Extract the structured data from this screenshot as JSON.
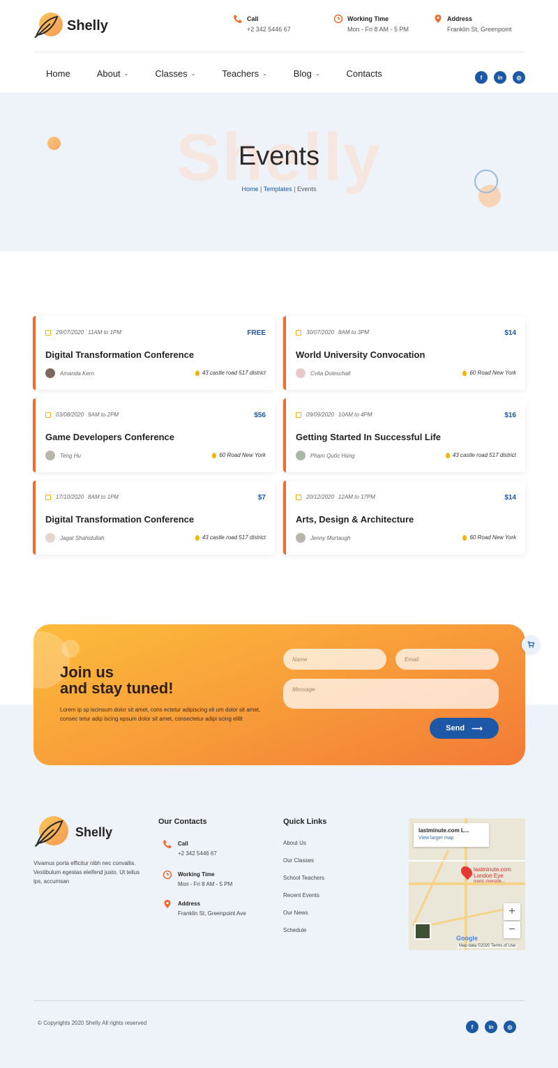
{
  "brand": {
    "name": "Shelly"
  },
  "header": {
    "call": {
      "title": "Call",
      "value": "+2 342 5446 67"
    },
    "working": {
      "title": "Working Time",
      "value": "Mon - Fri 8 AM - 5 PM"
    },
    "address": {
      "title": "Address",
      "value": "Franklin St, Greenpoint"
    }
  },
  "nav": {
    "items": [
      {
        "label": "Home"
      },
      {
        "label": "About"
      },
      {
        "label": "Classes"
      },
      {
        "label": "Teachers"
      },
      {
        "label": "Blog"
      },
      {
        "label": "Contacts"
      }
    ],
    "chevron": "⌄"
  },
  "social": {
    "facebook": "f",
    "linkedin": "in",
    "instagram": "◎"
  },
  "hero": {
    "bg_text": "Shelly",
    "title": "Events",
    "breadcrumb": {
      "home": "Home",
      "sep": " | ",
      "templates": "Templates",
      "current": "Events"
    }
  },
  "events": [
    {
      "date": "29/07/2020",
      "time": "11AM to 1PM",
      "price": "FREE",
      "title": "Digital Transformation Conference",
      "person": "Amanda Kern",
      "location": "43 castle road 517 district"
    },
    {
      "date": "30/07/2020",
      "time": "8AM to 3PM",
      "price": "$14",
      "title": "World University Convocation",
      "person": "Cvita Doleschall",
      "location": "60 Road New York"
    },
    {
      "date": "03/08/2020",
      "time": "9AM to 2PM",
      "price": "$56",
      "title": "Game Developers Conference",
      "person": "Teng Hu",
      "location": "60 Road New York"
    },
    {
      "date": "09/09/2020",
      "time": "10AM to 4PM",
      "price": "$16",
      "title": "Getting Started In Successful Life",
      "person": "Phạm Quốc Hùng",
      "location": "43 castle road 517 district"
    },
    {
      "date": "17/10/2020",
      "time": "8AM to 1PM",
      "price": "$7",
      "title": "Digital Transformation Conference",
      "person": "Jagat Shahidullah",
      "location": "43 castle road 517 district"
    },
    {
      "date": "20/12/2020",
      "time": "12AM to 17PM",
      "price": "$14",
      "title": "Arts, Design & Architecture",
      "person": "Jenny Murtaugh",
      "location": "60 Road New York"
    }
  ],
  "newsletter": {
    "heading_line1": "Join us",
    "heading_line2": "and stay tuned!",
    "text": "Lorem ip sp iscinsum dolor sit amet, cons ectetur adipiscing eli um dolor sit amet, consec tetur adip iscing epsum dolor sit amet, consectetur adipi scing elilit",
    "name_placeholder": "Name",
    "email_placeholder": "Email",
    "message_placeholder": "Message",
    "send_label": "Send",
    "send_arrow": "⟶"
  },
  "footer": {
    "about": "Vivamus porta efficitur nibh nec convallis. Vestibulum egestas eleifend justo. Ut tellus ips, accumsan",
    "contacts_title": "Our Contacts",
    "call": {
      "title": "Call",
      "value": "+2 342 5446 67"
    },
    "working": {
      "title": "Working Time",
      "value": "Mon - Fri 8 AM - 5 PM"
    },
    "address": {
      "title": "Address",
      "value": "Franklin St, Greenpoint Ave"
    },
    "quick_title": "Quick Links",
    "quick_links": [
      "About Us",
      "Our Classes",
      "School Teachers",
      "Recent Events",
      "Our News",
      "Schedule"
    ],
    "map": {
      "place": "lastminute.com L...",
      "larger": "View larger map",
      "pin_label_1": "lastminute.com",
      "pin_label_2": "London Eye",
      "pin_label_3": "Iconic riverside...",
      "zoom_in": "+",
      "zoom_out": "−",
      "google": "Google",
      "attribution": "Map data ©2020   Terms of Use"
    },
    "copyright": "© Copyrights 2020 Shelly All rights reserved"
  },
  "colors": {
    "accent_orange": "#f26a2e",
    "brand_blue": "#1c58a6",
    "gold": "#f7b500",
    "hero_bg": "#eef3fa"
  }
}
